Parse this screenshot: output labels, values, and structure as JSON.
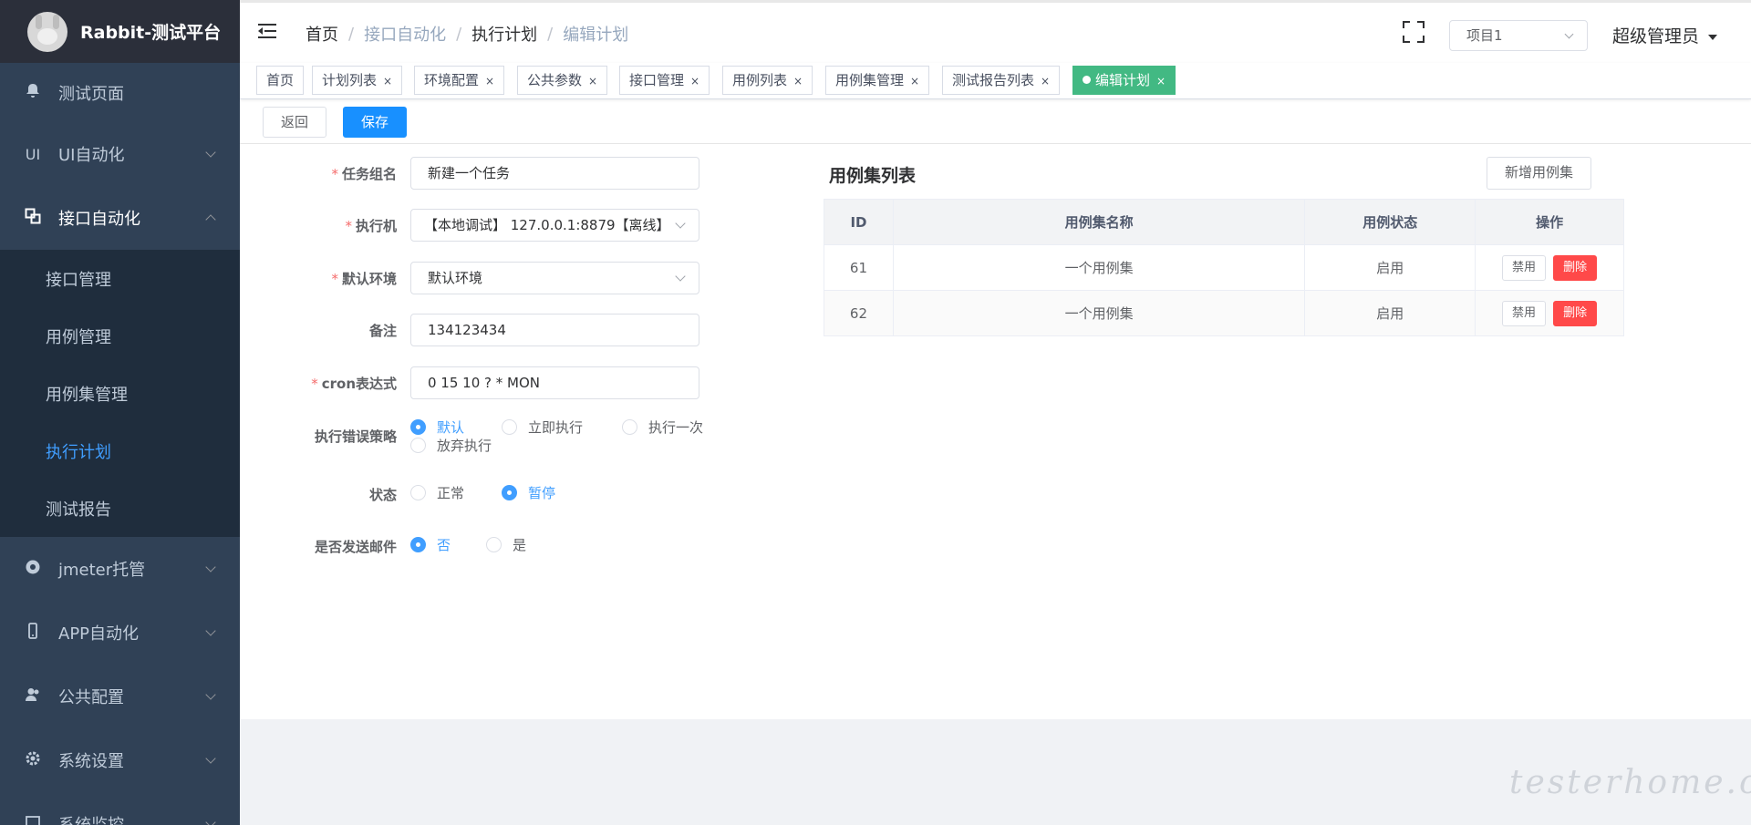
{
  "brand": {
    "title": "Rabbit-测试平台"
  },
  "sidebar": {
    "items": [
      {
        "label": "测试页面",
        "icon": "bell-icon"
      },
      {
        "label": "UI自动化",
        "icon": "ui-icon",
        "icon_text": "UI"
      },
      {
        "label": "接口自动化",
        "icon": "interface-icon"
      },
      {
        "label": "jmeter托管",
        "icon": "chrome-icon"
      },
      {
        "label": "APP自动化",
        "icon": "phone-icon"
      },
      {
        "label": "公共配置",
        "icon": "users-icon"
      },
      {
        "label": "系统设置",
        "icon": "gear-icon"
      },
      {
        "label": "系统监控",
        "icon": "monitor-icon"
      }
    ],
    "sub_items": [
      "接口管理",
      "用例管理",
      "用例集管理",
      "执行计划",
      "测试报告"
    ],
    "active_sub": "执行计划"
  },
  "navbar": {
    "breadcrumb": [
      "首页",
      "接口自动化",
      "执行计划",
      "编辑计划"
    ],
    "project": "项目1",
    "user": "超级管理员"
  },
  "tags": [
    {
      "label": "首页"
    },
    {
      "label": "计划列表",
      "close": "×"
    },
    {
      "label": "环境配置",
      "close": "×"
    },
    {
      "label": "公共参数",
      "close": "×"
    },
    {
      "label": "接口管理",
      "close": "×"
    },
    {
      "label": "用例列表",
      "close": "×"
    },
    {
      "label": "用例集管理",
      "close": "×"
    },
    {
      "label": "测试报告列表",
      "close": "×"
    },
    {
      "label": "编辑计划",
      "close": "×",
      "active": true
    }
  ],
  "toolbar": {
    "back": "返回",
    "save": "保存"
  },
  "form": {
    "name": {
      "label": "任务组名",
      "value": "新建一个任务"
    },
    "executor": {
      "label": "执行机",
      "value": "【本地调试】 127.0.0.1:8879【离线】"
    },
    "env": {
      "label": "默认环境",
      "value": "默认环境"
    },
    "remark": {
      "label": "备注",
      "value": "134123434"
    },
    "cron": {
      "label": "cron表达式",
      "value": "0 15 10 ? * MON"
    },
    "strategy": {
      "label": "执行错误策略",
      "options": [
        "默认",
        "立即执行",
        "执行一次",
        "放弃执行"
      ],
      "selected": "默认"
    },
    "status": {
      "label": "状态",
      "options": [
        "正常",
        "暂停"
      ],
      "selected": "暂停"
    },
    "email": {
      "label": "是否发送邮件",
      "options": [
        "否",
        "是"
      ],
      "selected": "否"
    }
  },
  "caseset": {
    "title": "用例集列表",
    "add_button": "新增用例集",
    "columns": [
      "ID",
      "用例集名称",
      "用例状态",
      "操作"
    ],
    "rows": [
      {
        "id": "61",
        "name": "一个用例集",
        "status": "启用",
        "disable": "禁用",
        "delete": "删除"
      },
      {
        "id": "62",
        "name": "一个用例集",
        "status": "启用",
        "disable": "禁用",
        "delete": "删除"
      }
    ]
  },
  "watermark": "testerhome.com",
  "colors": {
    "sidebar_bg": "#304156",
    "active_blue": "#409eff",
    "tag_active": "#42b983",
    "danger": "#ff4949",
    "primary": "#1890ff"
  }
}
